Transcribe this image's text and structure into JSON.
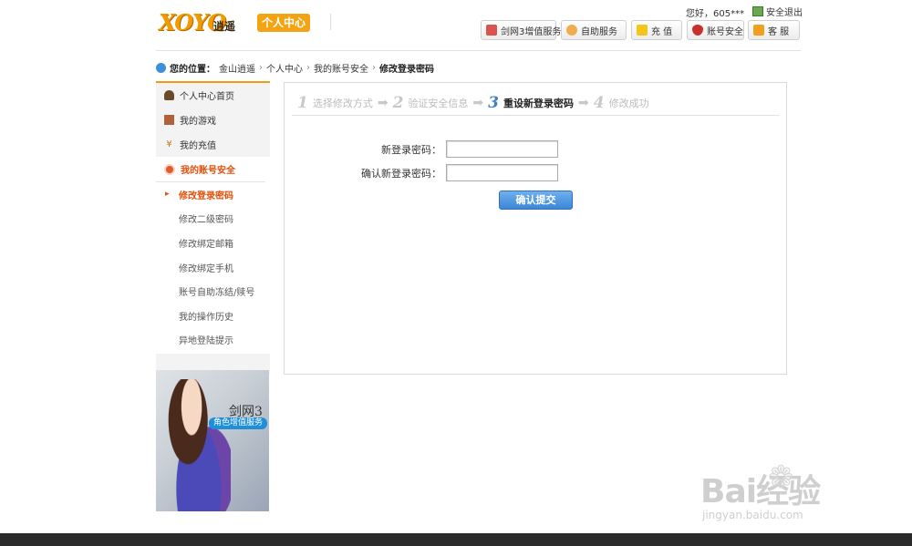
{
  "header": {
    "logo_text": "XOYO",
    "logo_sub": "逍遥",
    "logo_badge": "个人中心",
    "greeting": "您好，605***",
    "logout": "安全退出",
    "buttons": [
      {
        "label": "剑网3增值服务",
        "icon": "jx3-icon",
        "color": "#d9534f"
      },
      {
        "label": "自助服务",
        "icon": "user-service-icon",
        "color": "#f0ad4e"
      },
      {
        "label": "充 值",
        "icon": "recharge-icon",
        "color": "#f5c518"
      },
      {
        "label": "账号安全",
        "icon": "shield-icon",
        "color": "#c9302c"
      },
      {
        "label": "客 服",
        "icon": "handshake-icon",
        "color": "#f0a020"
      }
    ]
  },
  "breadcrumb": {
    "label": "您的位置：",
    "items": [
      "金山逍遥",
      "个人中心",
      "我的账号安全"
    ],
    "current": "修改登录密码"
  },
  "sidebar": {
    "items": [
      {
        "label": "个人中心首页",
        "icon": "person-icon"
      },
      {
        "label": "我的游戏",
        "icon": "game-icon"
      },
      {
        "label": "我的充值",
        "icon": "yen-icon"
      }
    ],
    "active_section": "我的账号安全",
    "subitems": [
      {
        "label": "修改登录密码",
        "active": true
      },
      {
        "label": "修改二级密码",
        "active": false
      },
      {
        "label": "修改绑定邮箱",
        "active": false
      },
      {
        "label": "修改绑定手机",
        "active": false
      },
      {
        "label": "账号自助冻结/赎号",
        "active": false
      },
      {
        "label": "我的操作历史",
        "active": false
      },
      {
        "label": "异地登陆提示",
        "active": false
      }
    ]
  },
  "banner": {
    "title": "剑网3",
    "tag": "角色增值服务"
  },
  "steps": [
    {
      "num": "1",
      "label": "选择修改方式",
      "active": false
    },
    {
      "num": "2",
      "label": "验证安全信息",
      "active": false
    },
    {
      "num": "3",
      "label": "重设新登录密码",
      "active": true
    },
    {
      "num": "4",
      "label": "修改成功",
      "active": false
    }
  ],
  "form": {
    "new_password_label": "新登录密码：",
    "new_password_value": "",
    "confirm_password_label": "确认新登录密码：",
    "confirm_password_value": "",
    "submit_label": "确认提交"
  },
  "watermark": {
    "text": "Bai经验",
    "url": "jingyan.baidu.com"
  },
  "colors": {
    "accent_orange": "#e2500a",
    "step_active_blue": "#3d7fc8",
    "button_blue": "#3c86d6"
  }
}
